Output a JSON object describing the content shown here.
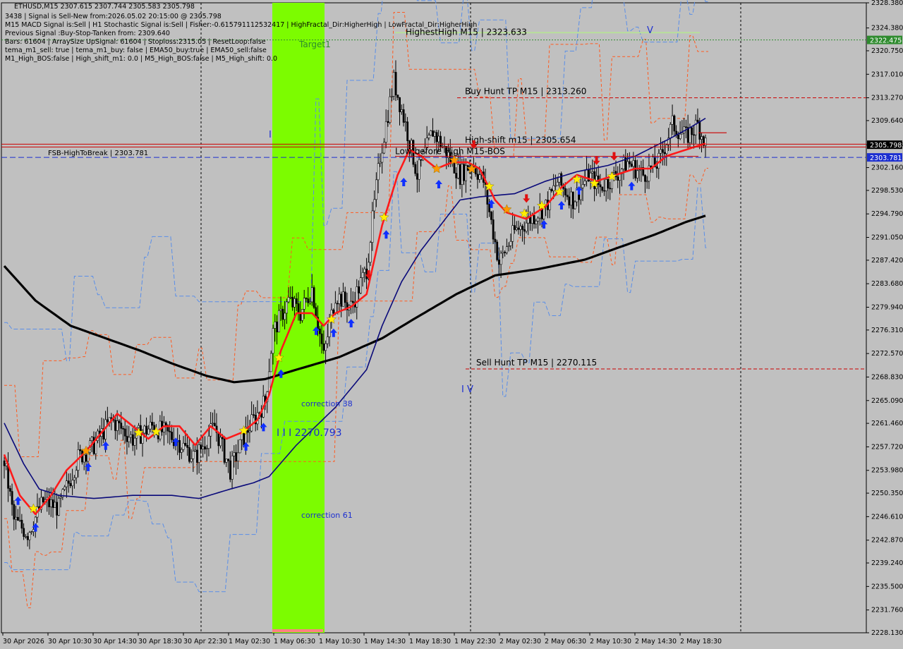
{
  "window": {
    "symbol_line": "ETHUSD,M15  2307.615 2307.744 2305.583 2305.798",
    "info_lines": [
      "3438 | Signal is Sell-New from:2026.05.02 20:15:00 @ 2305.798",
      "M15 MACD Signal is:Sell | H1 Stochastic Signal is:Sell | Fisher:-0.615791112532417 | HighFractal_Dir:HigherHigh | LowFractal_Dir:HigherHigh",
      "Previous Signal :Buy-Stop-Tanken from: 2309.640",
      "Bars: 61604 | ArraySize UpSignal: 61604 | Stoploss:2315.05 | ResetLoop:false",
      "tema_m1_sell: true | tema_m1_buy: false | EMA50_buy:true | EMA50_sell:false",
      "M1_High_BOS:false | High_shift_m1: 0.0 | M5_High_BOS:false | M5_High_shift: 0.0"
    ]
  },
  "chart_data": {
    "type": "candlestick",
    "symbol": "ETHUSD",
    "timeframe": "M15",
    "ylim": [
      2228.13,
      2328.38
    ],
    "price_ticks": [
      "2328.380",
      "2324.380",
      "2320.750",
      "2317.010",
      "2313.270",
      "2309.640",
      "2305.798",
      "2302.160",
      "2298.530",
      "2294.790",
      "2291.050",
      "2287.420",
      "2283.680",
      "2279.940",
      "2276.310",
      "2272.570",
      "2268.830",
      "2265.090",
      "2261.460",
      "2257.720",
      "2253.980",
      "2250.350",
      "2246.610",
      "2242.870",
      "2239.240",
      "2235.500",
      "2231.760",
      "2228.130"
    ],
    "time_ticks": [
      "30 Apr 2026",
      "30 Apr 10:30",
      "30 Apr 14:30",
      "30 Apr 18:30",
      "30 Apr 22:30",
      "1 May 02:30",
      "1 May 06:30",
      "1 May 10:30",
      "1 May 14:30",
      "1 May 18:30",
      "1 May 22:30",
      "2 May 02:30",
      "2 May 06:30",
      "2 May 10:30",
      "2 May 14:30",
      "2 May 18:30"
    ],
    "price_badges": [
      {
        "label": "2322.475",
        "price": 2322.475,
        "color": "#2e8b2e"
      },
      {
        "label": "2305.798",
        "price": 2305.798,
        "color": "#000000"
      },
      {
        "label": "2303.781",
        "price": 2303.781,
        "color": "#1c2fd0"
      }
    ],
    "levels": [
      {
        "label": "HighestHigh   M15 | 2323.633",
        "price": 2323.633,
        "color": "#b8e09a"
      },
      {
        "label": "Buy Hunt TP M15 | 2313.260",
        "price": 2313.26,
        "color": "#cc0000"
      },
      {
        "label": "High-shift m15 | 2305.654",
        "price": 2305.654,
        "color": "#cc0000"
      },
      {
        "label": "Low before High   M15-BOS",
        "price": 2304.4,
        "color": "#cc0000"
      },
      {
        "label": "FSB-HighToBreak | 2303.781",
        "price": 2303.781,
        "color": "#1c2fd0"
      },
      {
        "label": "Sell Hunt TP M15 | 2270.115",
        "price": 2270.115,
        "color": "#cc0000"
      }
    ],
    "annotations": [
      {
        "label": "Target1",
        "color": "#2e8b2e"
      },
      {
        "label": "correction 38",
        "color": "#1c2fd0"
      },
      {
        "label": "correction 61",
        "color": "#1c2fd0"
      },
      {
        "label": "I I I 2270.793",
        "color": "#1c2fd0"
      },
      {
        "label": "I V",
        "color": "#1c2fd0"
      },
      {
        "label": "V",
        "color": "#1c2fd0"
      },
      {
        "label": "I",
        "color": "#1c2fd0"
      }
    ],
    "series": [
      {
        "name": "close",
        "color": "#000000",
        "anchors": [
          [
            0,
            2255.5
          ],
          [
            5,
            2246
          ],
          [
            12,
            2244
          ],
          [
            20,
            2249
          ],
          [
            28,
            2248
          ],
          [
            38,
            2256
          ],
          [
            46,
            2258
          ],
          [
            55,
            2262
          ],
          [
            66,
            2259
          ],
          [
            76,
            2261
          ],
          [
            88,
            2259
          ],
          [
            98,
            2256
          ],
          [
            108,
            2261
          ],
          [
            116,
            2254
          ],
          [
            124,
            2260
          ],
          [
            134,
            2265
          ],
          [
            138,
            2276
          ],
          [
            146,
            2281
          ],
          [
            152,
            2279
          ],
          [
            158,
            2283
          ],
          [
            164,
            2272
          ],
          [
            170,
            2282
          ],
          [
            178,
            2280
          ],
          [
            186,
            2286
          ],
          [
            193,
            2304
          ],
          [
            200,
            2316
          ],
          [
            206,
            2309
          ],
          [
            212,
            2301
          ],
          [
            220,
            2308
          ],
          [
            228,
            2304
          ],
          [
            234,
            2301
          ],
          [
            240,
            2303
          ],
          [
            246,
            2300
          ],
          [
            254,
            2287
          ],
          [
            262,
            2292
          ],
          [
            270,
            2294
          ],
          [
            278,
            2296
          ],
          [
            284,
            2300
          ],
          [
            292,
            2297
          ],
          [
            300,
            2301
          ],
          [
            306,
            2299
          ],
          [
            314,
            2301
          ],
          [
            320,
            2303
          ],
          [
            328,
            2301
          ],
          [
            336,
            2303
          ],
          [
            343,
            2309
          ],
          [
            350,
            2307
          ],
          [
            356,
            2309
          ],
          [
            360,
            2306
          ]
        ]
      },
      {
        "name": "ema_red",
        "color": "#ff1a1a",
        "anchors": [
          [
            0,
            2256.5
          ],
          [
            8,
            2250
          ],
          [
            16,
            2247
          ],
          [
            24,
            2250
          ],
          [
            32,
            2254
          ],
          [
            42,
            2257
          ],
          [
            50,
            2260
          ],
          [
            58,
            2263
          ],
          [
            66,
            2261
          ],
          [
            74,
            2259
          ],
          [
            82,
            2261
          ],
          [
            90,
            2261
          ],
          [
            98,
            2258
          ],
          [
            106,
            2261
          ],
          [
            114,
            2259
          ],
          [
            122,
            2260
          ],
          [
            130,
            2262
          ],
          [
            136,
            2266
          ],
          [
            142,
            2273
          ],
          [
            150,
            2279
          ],
          [
            158,
            2279
          ],
          [
            164,
            2277
          ],
          [
            170,
            2279
          ],
          [
            178,
            2280
          ],
          [
            186,
            2282
          ],
          [
            194,
            2293
          ],
          [
            202,
            2301
          ],
          [
            208,
            2305
          ],
          [
            214,
            2304
          ],
          [
            222,
            2302
          ],
          [
            230,
            2303
          ],
          [
            238,
            2303
          ],
          [
            244,
            2302
          ],
          [
            252,
            2297
          ],
          [
            258,
            2295
          ],
          [
            268,
            2294
          ],
          [
            278,
            2296
          ],
          [
            286,
            2299
          ],
          [
            294,
            2301
          ],
          [
            304,
            2300
          ],
          [
            314,
            2301
          ],
          [
            324,
            2302
          ],
          [
            332,
            2302
          ],
          [
            340,
            2304
          ],
          [
            350,
            2305
          ],
          [
            360,
            2306
          ]
        ]
      },
      {
        "name": "ema_blue",
        "color": "#0a0a7a",
        "anchors": [
          [
            0,
            2261.5
          ],
          [
            10,
            2255
          ],
          [
            18,
            2251
          ],
          [
            28,
            2250
          ],
          [
            46,
            2249.5
          ],
          [
            66,
            2250
          ],
          [
            86,
            2250
          ],
          [
            100,
            2249.5
          ],
          [
            116,
            2251
          ],
          [
            128,
            2252
          ],
          [
            136,
            2253
          ],
          [
            150,
            2258
          ],
          [
            170,
            2264
          ],
          [
            186,
            2270
          ],
          [
            194,
            2277
          ],
          [
            204,
            2284
          ],
          [
            214,
            2289
          ],
          [
            224,
            2293
          ],
          [
            234,
            2297
          ],
          [
            244,
            2297.5
          ],
          [
            262,
            2298
          ],
          [
            278,
            2300
          ],
          [
            294,
            2301.5
          ],
          [
            310,
            2302.5
          ],
          [
            324,
            2304
          ],
          [
            340,
            2306.5
          ],
          [
            352,
            2308.5
          ],
          [
            360,
            2310
          ]
        ]
      },
      {
        "name": "sma_black",
        "color": "#000000",
        "anchors": [
          [
            0,
            2286.5
          ],
          [
            16,
            2281
          ],
          [
            34,
            2277
          ],
          [
            52,
            2275
          ],
          [
            70,
            2273
          ],
          [
            86,
            2271
          ],
          [
            104,
            2269
          ],
          [
            118,
            2268
          ],
          [
            134,
            2268.5
          ],
          [
            150,
            2270
          ],
          [
            172,
            2272
          ],
          [
            194,
            2275
          ],
          [
            210,
            2278
          ],
          [
            232,
            2282
          ],
          [
            252,
            2285
          ],
          [
            274,
            2286
          ],
          [
            298,
            2287.5
          ],
          [
            316,
            2289.5
          ],
          [
            334,
            2291.5
          ],
          [
            350,
            2293.5
          ],
          [
            360,
            2294.5
          ]
        ]
      }
    ]
  }
}
